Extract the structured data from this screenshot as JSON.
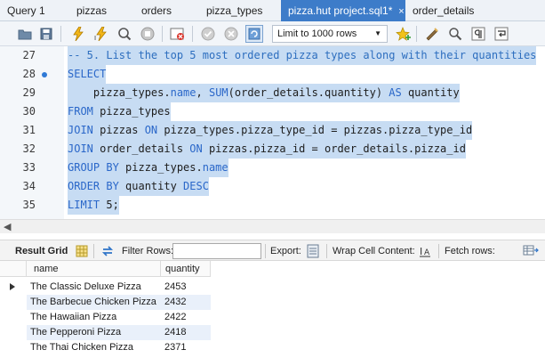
{
  "tabs": [
    {
      "label": "Query 1"
    },
    {
      "label": "pizzas"
    },
    {
      "label": "orders"
    },
    {
      "label": "pizza_types"
    },
    {
      "label": "pizza.hut project.sql1*"
    },
    {
      "label": "order_details"
    }
  ],
  "tab_close_glyph": "×",
  "toolbar": {
    "limit_label": "Limit to 1000 rows"
  },
  "editor": {
    "lines": [
      {
        "num": "27",
        "text": "-- 5. List the top 5 most ordered pizza types along with their quantities"
      },
      {
        "num": "28",
        "text": "SELECT"
      },
      {
        "num": "29",
        "text": "    pizza_types.name, SUM(order_details.quantity) AS quantity"
      },
      {
        "num": "30",
        "text": "FROM pizza_types"
      },
      {
        "num": "31",
        "text": "JOIN pizzas ON pizza_types.pizza_type_id = pizzas.pizza_type_id"
      },
      {
        "num": "32",
        "text": "JOIN order_details ON pizzas.pizza_id = order_details.pizza_id"
      },
      {
        "num": "33",
        "text": "GROUP BY pizza_types.name"
      },
      {
        "num": "34",
        "text": "ORDER BY quantity DESC"
      },
      {
        "num": "35",
        "text": "LIMIT 5;"
      }
    ],
    "tokens": {
      "l29": {
        "indent": "    ",
        "a": "pizza_types.",
        "b": "name",
        "c": ", ",
        "d": "SUM",
        "e": "(order_details.quantity) ",
        "f": "AS",
        "g": " quantity"
      },
      "l30": {
        "a": "FROM",
        "b": " pizza_types"
      },
      "l31": {
        "a": "JOIN",
        "b": " pizzas ",
        "c": "ON",
        "d": " pizza_types.pizza_type_id = pizzas.pizza_type_id"
      },
      "l32": {
        "a": "JOIN",
        "b": " order_details ",
        "c": "ON",
        "d": " pizzas.pizza_id = order_details.pizza_id"
      },
      "l33": {
        "a": "GROUP BY",
        "b": " pizza_types.",
        "c": "name"
      },
      "l34": {
        "a": "ORDER BY",
        "b": " quantity ",
        "c": "DESC"
      },
      "l35": {
        "a": "LIMIT",
        "b": " 5",
        "c": ";"
      }
    }
  },
  "result_toolbar": {
    "result_grid": "Result Grid",
    "filter_rows": "Filter Rows:",
    "filter_value": "",
    "export": "Export:",
    "wrap": "Wrap Cell Content:",
    "fetch": "Fetch rows:"
  },
  "grid": {
    "columns": [
      "name",
      "quantity"
    ],
    "rows": [
      {
        "name": "The Classic Deluxe Pizza",
        "quantity": "2453"
      },
      {
        "name": "The Barbecue Chicken Pizza",
        "quantity": "2432"
      },
      {
        "name": "The Hawaiian Pizza",
        "quantity": "2422"
      },
      {
        "name": "The Pepperoni Pizza",
        "quantity": "2418"
      },
      {
        "name": "The Thai Chicken Pizza",
        "quantity": "2371"
      }
    ]
  },
  "colors": {
    "accent": "#3d7cc9",
    "keyword": "#2a67c9",
    "selection": "#c7dcf3"
  },
  "icons": [
    "folder-icon",
    "save-icon",
    "execute-icon",
    "execute-current-icon",
    "explain-icon",
    "stop-icon",
    "toggle-error-icon",
    "commit-icon",
    "rollback-icon",
    "autocommit-icon",
    "add-snippet-icon",
    "beautify-icon",
    "find-icon",
    "invisible-chars-icon",
    "wrap-icon",
    "grid-icon",
    "refresh-icon",
    "export-icon",
    "wrap-cell-icon",
    "fetch-rows-icon"
  ]
}
